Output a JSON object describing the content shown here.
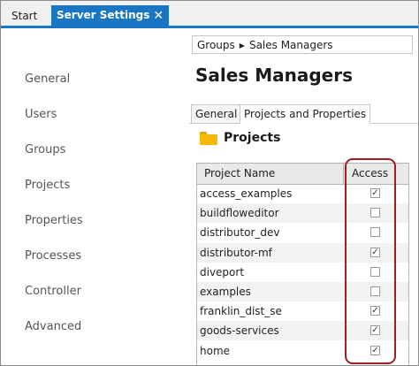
{
  "tabs": {
    "start_label": "Start",
    "active_label": "Server Settings",
    "close_glyph": "✕"
  },
  "sidenav": {
    "items": [
      {
        "label": "General"
      },
      {
        "label": "Users"
      },
      {
        "label": "Groups"
      },
      {
        "label": "Projects"
      },
      {
        "label": "Properties"
      },
      {
        "label": "Processes"
      },
      {
        "label": "Controller"
      },
      {
        "label": "Advanced"
      }
    ]
  },
  "breadcrumb": {
    "root": "Groups",
    "separator_icon": "triangle-right-icon",
    "current": "Sales Managers"
  },
  "page_title": "Sales Managers",
  "subtabs": {
    "general": "General",
    "projects_properties": "Projects and Properties"
  },
  "section": {
    "icon": "folder-icon",
    "title": "Projects"
  },
  "table": {
    "col_name": "Project Name",
    "col_access": "Access",
    "rows": [
      {
        "name": "access_examples",
        "access": true
      },
      {
        "name": "buildfloweditor",
        "access": false
      },
      {
        "name": "distributor_dev",
        "access": false
      },
      {
        "name": "distributor-mf",
        "access": true
      },
      {
        "name": "diveport",
        "access": false
      },
      {
        "name": "examples",
        "access": false
      },
      {
        "name": "franklin_dist_se",
        "access": true
      },
      {
        "name": "goods-services",
        "access": true
      },
      {
        "name": "home",
        "access": true
      }
    ]
  },
  "colors": {
    "accent": "#1976c2",
    "highlight": "#a01c24",
    "folder": "#f6b900"
  }
}
